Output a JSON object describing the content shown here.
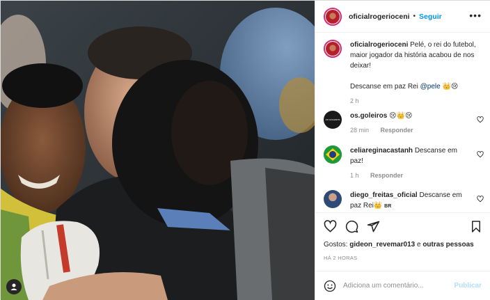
{
  "post": {
    "username": "oficialrogerioceni",
    "separator": "•",
    "follow_label": "Seguir",
    "more_label": "•••"
  },
  "caption": {
    "username": "oficialrogerioceni",
    "text_before_mention": " Pelé, o rei do futebol, maior jogador da história acabou de nos deixar!",
    "line2_before": "Descanse em paz Rei ",
    "mention": "@pele",
    "line2_after": " 👑😢",
    "time": "2 h"
  },
  "comments": [
    {
      "username": "os.goleiros",
      "text": " 😢👑😢",
      "time": "28 min",
      "reply": "Responder",
      "avatar_label": "OS GOLEIROS"
    },
    {
      "username": "celiareginacastanh",
      "text": " Descanse em paz!",
      "time": "1 h",
      "reply": "Responder"
    },
    {
      "username": "diego_freitas_oficial",
      "text": " Descanse em paz Rei👑 ",
      "flag": "BR"
    }
  ],
  "likes": {
    "prefix": "Gostos: ",
    "user": "gideon_revemar013",
    "connector": " e ",
    "others": "outras pessoas"
  },
  "timestamp": "HÁ 2 HORAS",
  "add_comment": {
    "placeholder": "Adiciona um comentário...",
    "publish_label": "Publicar"
  },
  "colors": {
    "link": "#0095f6",
    "publish_disabled": "#b2dffc",
    "muted": "#8e8e8e",
    "text": "#262626",
    "story_ring": "#d62976"
  },
  "icons": [
    "user-tag-icon",
    "heart-icon",
    "comment-icon",
    "share-icon",
    "bookmark-icon",
    "emoji-icon",
    "more-options-icon"
  ]
}
